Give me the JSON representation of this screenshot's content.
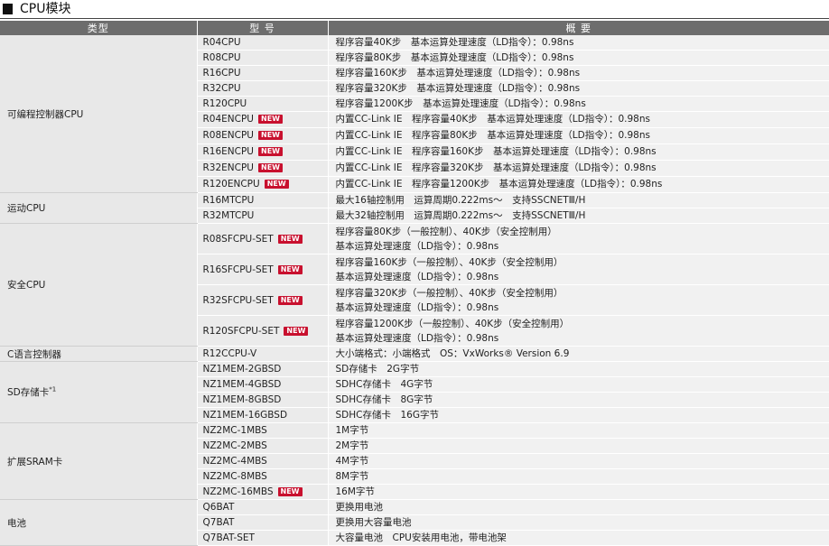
{
  "section_title": "CPU模块",
  "headers": {
    "type": "类型",
    "model": "型 号",
    "summary": "概 要"
  },
  "badge_text": "NEW",
  "groups": [
    {
      "category": "可编程控制器CPU",
      "rows": [
        {
          "model": "R04CPU",
          "desc": [
            "程序容量40K步　基本运算处理速度（LD指令）：0.98ns"
          ]
        },
        {
          "model": "R08CPU",
          "desc": [
            "程序容量80K步　基本运算处理速度（LD指令）：0.98ns"
          ]
        },
        {
          "model": "R16CPU",
          "desc": [
            "程序容量160K步　基本运算处理速度（LD指令）：0.98ns"
          ]
        },
        {
          "model": "R32CPU",
          "desc": [
            "程序容量320K步　基本运算处理速度（LD指令）：0.98ns"
          ]
        },
        {
          "model": "R120CPU",
          "desc": [
            "程序容量1200K步　基本运算处理速度（LD指令）：0.98ns"
          ]
        },
        {
          "model": "R04ENCPU",
          "new": true,
          "desc": [
            "内置CC-Link IE　程序容量40K步　基本运算处理速度（LD指令）：0.98ns"
          ]
        },
        {
          "model": "R08ENCPU",
          "new": true,
          "desc": [
            "内置CC-Link IE　程序容量80K步　基本运算处理速度（LD指令）：0.98ns"
          ]
        },
        {
          "model": "R16ENCPU",
          "new": true,
          "desc": [
            "内置CC-Link IE　程序容量160K步　基本运算处理速度（LD指令）：0.98ns"
          ]
        },
        {
          "model": "R32ENCPU",
          "new": true,
          "desc": [
            "内置CC-Link IE　程序容量320K步　基本运算处理速度（LD指令）：0.98ns"
          ]
        },
        {
          "model": "R120ENCPU",
          "new": true,
          "desc": [
            "内置CC-Link IE　程序容量1200K步　基本运算处理速度（LD指令）：0.98ns"
          ]
        }
      ]
    },
    {
      "category": "运动CPU",
      "rows": [
        {
          "model": "R16MTCPU",
          "desc": [
            "最大16轴控制用　运算周期0.222ms～　支持SSCNETⅢ/H"
          ]
        },
        {
          "model": "R32MTCPU",
          "desc": [
            "最大32轴控制用　运算周期0.222ms～　支持SSCNETⅢ/H"
          ]
        }
      ]
    },
    {
      "category": "安全CPU",
      "rows": [
        {
          "model": "R08SFCPU-SET",
          "new": true,
          "desc": [
            "程序容量80K步（一般控制）、40K步（安全控制用）",
            "基本运算处理速度（LD指令）：0.98ns"
          ]
        },
        {
          "model": "R16SFCPU-SET",
          "new": true,
          "desc": [
            "程序容量160K步（一般控制）、40K步（安全控制用）",
            "基本运算处理速度（LD指令）：0.98ns"
          ]
        },
        {
          "model": "R32SFCPU-SET",
          "new": true,
          "desc": [
            "程序容量320K步（一般控制）、40K步（安全控制用）",
            "基本运算处理速度（LD指令）：0.98ns"
          ]
        },
        {
          "model": "R120SFCPU-SET",
          "new": true,
          "desc": [
            "程序容量1200K步（一般控制）、40K步（安全控制用）",
            "基本运算处理速度（LD指令）：0.98ns"
          ]
        }
      ]
    },
    {
      "category": "C语言控制器",
      "rows": [
        {
          "model": "R12CCPU-V",
          "desc": [
            "大小端格式：小端格式　OS：VxWorks® Version 6.9"
          ]
        }
      ]
    },
    {
      "category": "SD存储卡",
      "category_sup": "*1",
      "rows": [
        {
          "model": "NZ1MEM-2GBSD",
          "desc": [
            "SD存储卡　2G字节"
          ]
        },
        {
          "model": "NZ1MEM-4GBSD",
          "desc": [
            "SDHC存储卡　4G字节"
          ]
        },
        {
          "model": "NZ1MEM-8GBSD",
          "desc": [
            "SDHC存储卡　8G字节"
          ]
        },
        {
          "model": "NZ1MEM-16GBSD",
          "desc": [
            "SDHC存储卡　16G字节"
          ]
        }
      ]
    },
    {
      "category": "扩展SRAM卡",
      "rows": [
        {
          "model": "NZ2MC-1MBS",
          "desc": [
            "1M字节"
          ]
        },
        {
          "model": "NZ2MC-2MBS",
          "desc": [
            "2M字节"
          ]
        },
        {
          "model": "NZ2MC-4MBS",
          "desc": [
            "4M字节"
          ]
        },
        {
          "model": "NZ2MC-8MBS",
          "desc": [
            "8M字节"
          ]
        },
        {
          "model": "NZ2MC-16MBS",
          "new": true,
          "desc": [
            "16M字节"
          ]
        }
      ]
    },
    {
      "category": "电池",
      "rows": [
        {
          "model": "Q6BAT",
          "desc": [
            "更换用电池"
          ]
        },
        {
          "model": "Q7BAT",
          "desc": [
            "更换用大容量电池"
          ]
        },
        {
          "model": "Q7BAT-SET",
          "desc": [
            "大容量电池　CPU安装用电池，带电池架"
          ]
        }
      ]
    }
  ]
}
